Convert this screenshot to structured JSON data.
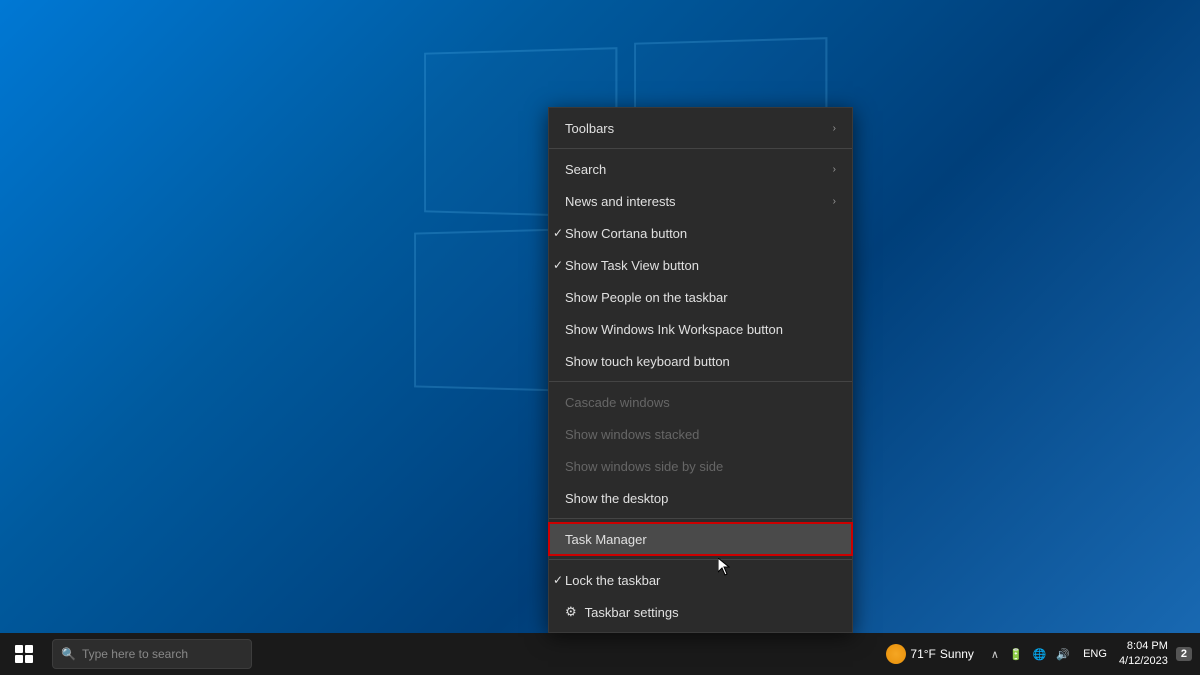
{
  "desktop": {
    "background_description": "Windows 10 blue gradient desktop"
  },
  "context_menu": {
    "items": [
      {
        "id": "toolbars",
        "label": "Toolbars",
        "has_arrow": true,
        "checked": false,
        "disabled": false,
        "separator_after": true,
        "has_icon": false
      },
      {
        "id": "search",
        "label": "Search",
        "has_arrow": true,
        "checked": false,
        "disabled": false,
        "separator_after": false,
        "has_icon": false
      },
      {
        "id": "news-interests",
        "label": "News and interests",
        "has_arrow": true,
        "checked": false,
        "disabled": false,
        "separator_after": false,
        "has_icon": false
      },
      {
        "id": "show-cortana",
        "label": "Show Cortana button",
        "has_arrow": false,
        "checked": true,
        "disabled": false,
        "separator_after": false,
        "has_icon": false
      },
      {
        "id": "show-task-view",
        "label": "Show Task View button",
        "has_arrow": false,
        "checked": true,
        "disabled": false,
        "separator_after": false,
        "has_icon": false
      },
      {
        "id": "show-people",
        "label": "Show People on the taskbar",
        "has_arrow": false,
        "checked": false,
        "disabled": false,
        "separator_after": false,
        "has_icon": false
      },
      {
        "id": "show-ink",
        "label": "Show Windows Ink Workspace button",
        "has_arrow": false,
        "checked": false,
        "disabled": false,
        "separator_after": false,
        "has_icon": false
      },
      {
        "id": "show-touch-keyboard",
        "label": "Show touch keyboard button",
        "has_arrow": false,
        "checked": false,
        "disabled": false,
        "separator_after": true,
        "has_icon": false
      },
      {
        "id": "cascade-windows",
        "label": "Cascade windows",
        "has_arrow": false,
        "checked": false,
        "disabled": true,
        "separator_after": false,
        "has_icon": false
      },
      {
        "id": "show-stacked",
        "label": "Show windows stacked",
        "has_arrow": false,
        "checked": false,
        "disabled": true,
        "separator_after": false,
        "has_icon": false
      },
      {
        "id": "show-side-by-side",
        "label": "Show windows side by side",
        "has_arrow": false,
        "checked": false,
        "disabled": true,
        "separator_after": false,
        "has_icon": false
      },
      {
        "id": "show-desktop",
        "label": "Show the desktop",
        "has_arrow": false,
        "checked": false,
        "disabled": false,
        "separator_after": true,
        "has_icon": false
      },
      {
        "id": "task-manager",
        "label": "Task Manager",
        "has_arrow": false,
        "checked": false,
        "disabled": false,
        "separator_after": true,
        "has_icon": false,
        "highlighted": true
      },
      {
        "id": "lock-taskbar",
        "label": "Lock the taskbar",
        "has_arrow": false,
        "checked": true,
        "disabled": false,
        "separator_after": false,
        "has_icon": false
      },
      {
        "id": "taskbar-settings",
        "label": "Taskbar settings",
        "has_arrow": false,
        "checked": false,
        "disabled": false,
        "separator_after": false,
        "has_icon": true
      }
    ]
  },
  "taskbar": {
    "weather_temp": "71°F",
    "weather_condition": "Sunny",
    "time": "8:04 PM",
    "date": "4/12/2023",
    "lang": "ENG",
    "notification_count": "2"
  }
}
